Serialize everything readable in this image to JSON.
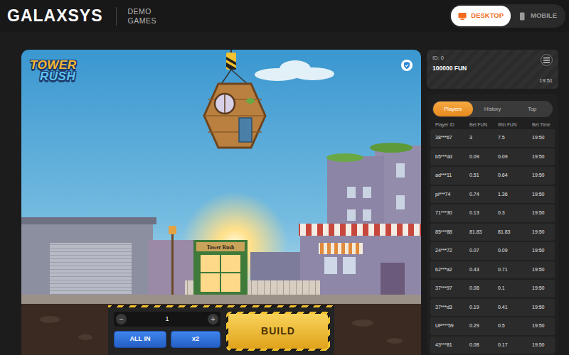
{
  "header": {
    "brand": "GALAXSYS",
    "subtitle": [
      "DEMO",
      "GAMES"
    ],
    "view_toggle": [
      {
        "label": "DESKTOP",
        "selected": true
      },
      {
        "label": "MOBILE",
        "selected": false
      }
    ]
  },
  "game": {
    "logo": [
      "TOWER",
      "RUSH"
    ],
    "shop_sign": "Tower Rush",
    "bet": {
      "minus": "−",
      "value": "1",
      "plus": "+"
    },
    "quick_buttons": [
      "ALL IN",
      "x2"
    ],
    "build_button": "BUILD"
  },
  "account": {
    "id": "ID: 0",
    "balance": "100000 FUN",
    "time": "19:51"
  },
  "bets": {
    "tabs": [
      {
        "label": "Players",
        "selected": true
      },
      {
        "label": "History",
        "selected": false
      },
      {
        "label": "Top",
        "selected": false
      }
    ],
    "columns": [
      "Player ID",
      "Bet FUN",
      "Win FUN",
      "Bet Time"
    ],
    "rows": [
      [
        "38***67",
        "3",
        "7.5",
        "19:50"
      ],
      [
        "b5***dd",
        "0.09",
        "0.09",
        "19:50"
      ],
      [
        "ad***11",
        "0.51",
        "0.64",
        "19:50"
      ],
      [
        "pi***74",
        "0.74",
        "1.36",
        "19:50"
      ],
      [
        "71***30",
        "0.13",
        "0.3",
        "19:50"
      ],
      [
        "85***88",
        "81.83",
        "81.83",
        "19:50"
      ],
      [
        "24***72",
        "0.07",
        "0.09",
        "19:50"
      ],
      [
        "b2***a2",
        "0.43",
        "0.71",
        "19:50"
      ],
      [
        "37***97",
        "0.08",
        "0.1",
        "19:50"
      ],
      [
        "37***d3",
        "0.19",
        "0.41",
        "19:50"
      ],
      [
        "UP***59",
        "0.29",
        "0.5",
        "19:50"
      ],
      [
        "43***81",
        "0.08",
        "0.17",
        "19:50"
      ]
    ]
  }
}
